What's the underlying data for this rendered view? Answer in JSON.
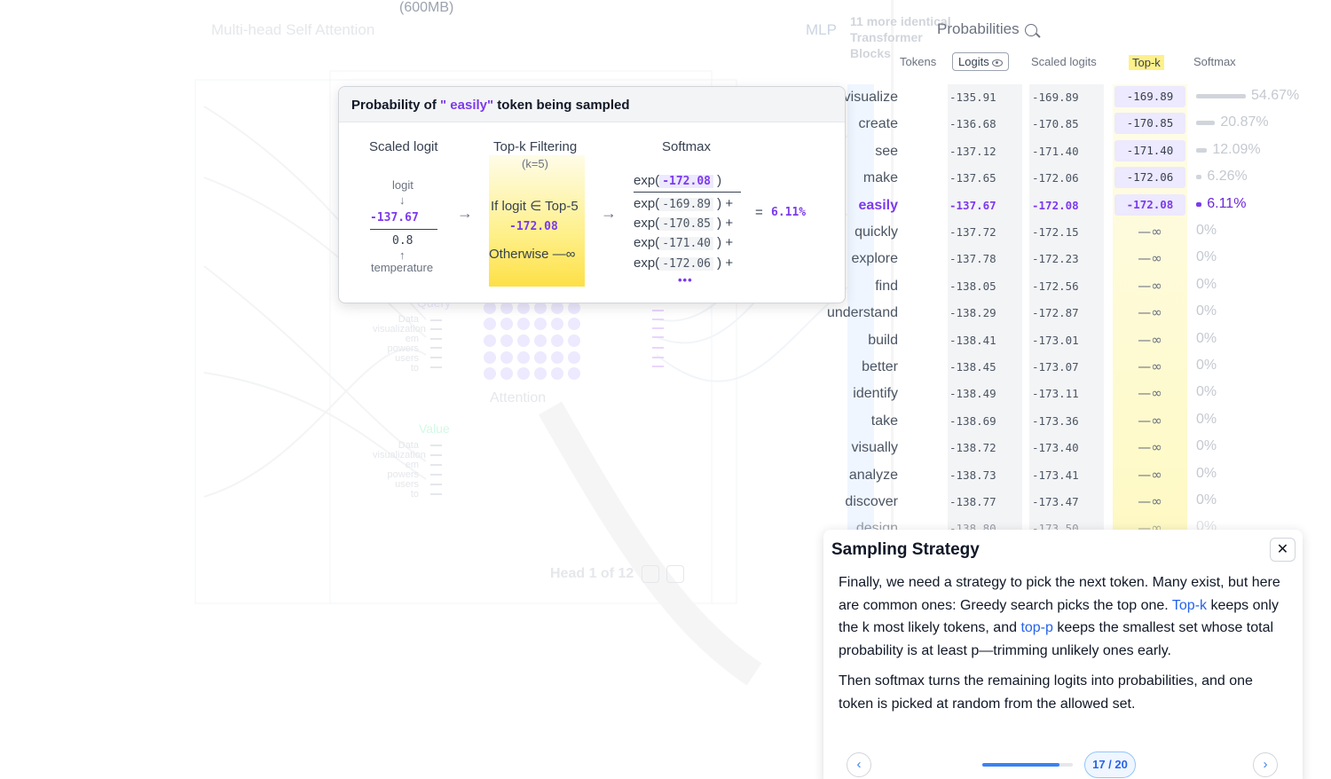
{
  "background": {
    "model_size": "(600MB)",
    "head_title": "Multi-head Self Attention",
    "mlp": "MLP",
    "blocks_label": "11 more identical Transformer Blocks",
    "attention_label": "Attention",
    "value_label": "Value",
    "query_label": "Query",
    "input_words": [
      "Data",
      "visualization",
      "em",
      "powers",
      "users",
      "to"
    ],
    "head_nav": "Head 1 of 12"
  },
  "probabilities": {
    "title": "Probabilities",
    "zoom_icon": "zoom-in-icon",
    "columns": {
      "tokens": "Tokens",
      "logits": "Logits",
      "scaled": "Scaled logits",
      "topk": "Top-k",
      "softmax": "Softmax"
    },
    "rows": [
      {
        "token": "visualize",
        "logit": "-135.91",
        "scaled": "-169.89",
        "topk": "-169.89",
        "softmax": "54.67%",
        "prob": 0.5467
      },
      {
        "token": "create",
        "logit": "-136.68",
        "scaled": "-170.85",
        "topk": "-170.85",
        "softmax": "20.87%",
        "prob": 0.2087
      },
      {
        "token": "see",
        "logit": "-137.12",
        "scaled": "-171.40",
        "topk": "-171.40",
        "softmax": "12.09%",
        "prob": 0.1209
      },
      {
        "token": "make",
        "logit": "-137.65",
        "scaled": "-172.06",
        "topk": "-172.06",
        "softmax": "6.26%",
        "prob": 0.0626
      },
      {
        "token": "easily",
        "logit": "-137.67",
        "scaled": "-172.08",
        "topk": "-172.08",
        "softmax": "6.11%",
        "prob": 0.0611
      },
      {
        "token": "quickly",
        "logit": "-137.72",
        "scaled": "-172.15",
        "topk": "—∞",
        "softmax": "0%",
        "prob": 0
      },
      {
        "token": "explore",
        "logit": "-137.78",
        "scaled": "-172.23",
        "topk": "—∞",
        "softmax": "0%",
        "prob": 0
      },
      {
        "token": "find",
        "logit": "-138.05",
        "scaled": "-172.56",
        "topk": "—∞",
        "softmax": "0%",
        "prob": 0
      },
      {
        "token": "understand",
        "logit": "-138.29",
        "scaled": "-172.87",
        "topk": "—∞",
        "softmax": "0%",
        "prob": 0
      },
      {
        "token": "build",
        "logit": "-138.41",
        "scaled": "-173.01",
        "topk": "—∞",
        "softmax": "0%",
        "prob": 0
      },
      {
        "token": "better",
        "logit": "-138.45",
        "scaled": "-173.07",
        "topk": "—∞",
        "softmax": "0%",
        "prob": 0
      },
      {
        "token": "identify",
        "logit": "-138.49",
        "scaled": "-173.11",
        "topk": "—∞",
        "softmax": "0%",
        "prob": 0
      },
      {
        "token": "take",
        "logit": "-138.69",
        "scaled": "-173.36",
        "topk": "—∞",
        "softmax": "0%",
        "prob": 0
      },
      {
        "token": "visually",
        "logit": "-138.72",
        "scaled": "-173.40",
        "topk": "—∞",
        "softmax": "0%",
        "prob": 0
      },
      {
        "token": "analyze",
        "logit": "-138.73",
        "scaled": "-173.41",
        "topk": "—∞",
        "softmax": "0%",
        "prob": 0
      },
      {
        "token": "discover",
        "logit": "-138.77",
        "scaled": "-173.47",
        "topk": "—∞",
        "softmax": "0%",
        "prob": 0
      },
      {
        "token": "design",
        "logit": "-138.80",
        "scaled": "-173.50",
        "topk": "—∞",
        "softmax": "0%",
        "prob": 0
      }
    ],
    "active_token": "easily"
  },
  "popup": {
    "title_prefix": "Probability of",
    "token": "\" easily\"",
    "title_suffix": "token being sampled",
    "scaled_logit": {
      "title": "Scaled logit",
      "logit_label": "logit",
      "down_arrow": "↓",
      "logit_value": "-137.67",
      "temp_value": "0.8",
      "up_arrow": "↑",
      "temp_label": "temperature"
    },
    "arrow": "→",
    "topk": {
      "title": "Top-k Filtering",
      "k": "(k=5)",
      "condition": "If logit ∈ Top-5",
      "value": "-172.08",
      "otherwise": "Otherwise —∞"
    },
    "softmax": {
      "title": "Softmax",
      "numerator": "-172.08",
      "denominators": [
        "-169.89",
        "-170.85",
        "-171.40",
        "-172.06"
      ],
      "exp": "exp(",
      "close": ")",
      "plus": "+",
      "ellipsis": "•••",
      "equals": "=",
      "result": "6.11%"
    }
  },
  "panel": {
    "title": "Sampling Strategy",
    "close": "✕",
    "p1_a": "Finally, we need a strategy to pick the next token. Many exist, but here are common ones: Greedy search picks the top one.",
    "p1_link1": "Top-k",
    "p1_b": "keeps only the k most likely tokens, and",
    "p1_link2": "top-p",
    "p1_c": "keeps the smallest set whose total probability is at least p—trimming unlikely ones early.",
    "p2": "Then softmax turns the remaining logits into probabilities, and one token is picked at random from the allowed set.",
    "prev": "‹",
    "next": "›",
    "page": "17 / 20",
    "progress": 0.85
  }
}
